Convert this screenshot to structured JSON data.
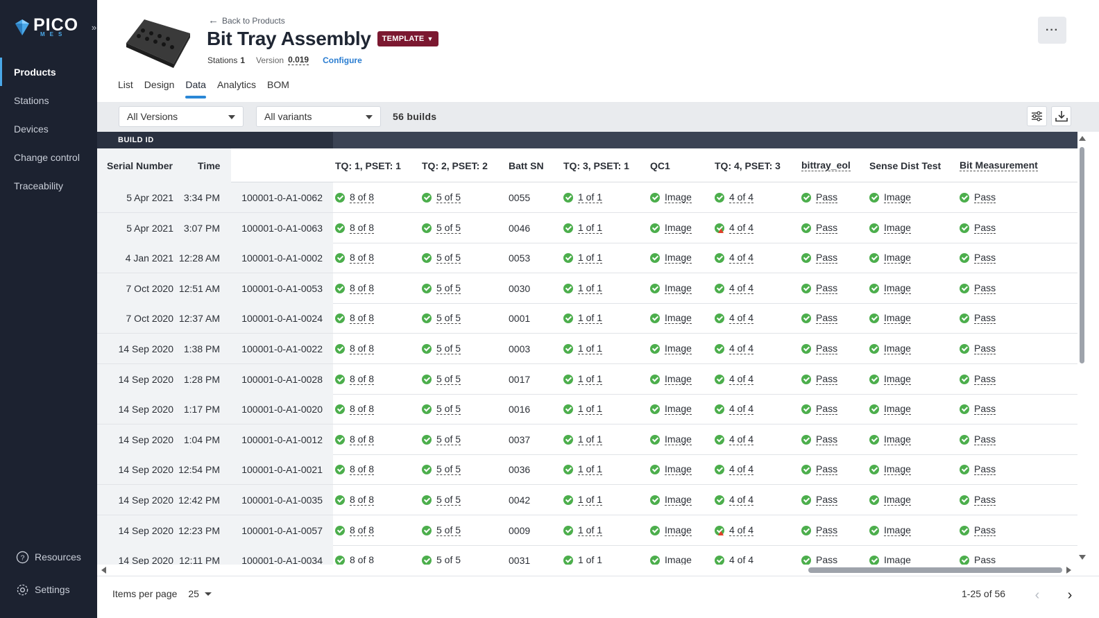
{
  "app": {
    "logo_main": "PICO",
    "logo_sub": "MES"
  },
  "sidebar": {
    "items": [
      {
        "label": "Products",
        "active": true
      },
      {
        "label": "Stations"
      },
      {
        "label": "Devices"
      },
      {
        "label": "Change control"
      },
      {
        "label": "Traceability"
      }
    ],
    "resources_label": "Resources",
    "settings_label": "Settings"
  },
  "header": {
    "back_label": "Back to Products",
    "title": "Bit Tray Assembly",
    "badge": "TEMPLATE",
    "stations_label": "Stations",
    "stations_value": "1",
    "version_label": "Version",
    "version_value": "0.019",
    "configure_label": "Configure",
    "more_label": "···"
  },
  "tabs": [
    "List",
    "Design",
    "Data",
    "Analytics",
    "BOM"
  ],
  "active_tab": "Data",
  "filters": {
    "versions": "All Versions",
    "variants": "All variants",
    "builds": "56 builds"
  },
  "table": {
    "build_id_label": "BUILD ID",
    "headers": {
      "serial": "Serial Number",
      "time": "Time",
      "tq1": "TQ: 1, PSET: 1",
      "tq2": "TQ: 2, PSET: 2",
      "batt": "Batt SN",
      "tq3": "TQ: 3, PSET: 1",
      "qc1": "QC1",
      "tq4": "TQ: 4, PSET: 3",
      "eol": "bittray_eol",
      "sense": "Sense Dist Test",
      "bit": "Bit Measurement"
    },
    "rows": [
      {
        "date": "5 Apr 2021",
        "time": "3:34 PM",
        "build": "100001-0-A1-0062",
        "tq1": "8 of 8",
        "tq2": "5 of 5",
        "batt": "0055",
        "tq3": "1 of 1",
        "qc1": "Image",
        "tq4": "4 of 4",
        "tq4_warn": false,
        "eol": "Pass",
        "sense": "Image",
        "bit": "Pass"
      },
      {
        "date": "5 Apr 2021",
        "time": "3:07 PM",
        "build": "100001-0-A1-0063",
        "tq1": "8 of 8",
        "tq2": "5 of 5",
        "batt": "0046",
        "tq3": "1 of 1",
        "qc1": "Image",
        "tq4": "4 of 4",
        "tq4_warn": true,
        "eol": "Pass",
        "sense": "Image",
        "bit": "Pass"
      },
      {
        "date": "4 Jan 2021",
        "time": "12:28 AM",
        "build": "100001-0-A1-0002",
        "tq1": "8 of 8",
        "tq2": "5 of 5",
        "batt": "0053",
        "tq3": "1 of 1",
        "qc1": "Image",
        "tq4": "4 of 4",
        "tq4_warn": false,
        "eol": "Pass",
        "sense": "Image",
        "bit": "Pass"
      },
      {
        "date": "7 Oct 2020",
        "time": "12:51 AM",
        "build": "100001-0-A1-0053",
        "tq1": "8 of 8",
        "tq2": "5 of 5",
        "batt": "0030",
        "tq3": "1 of 1",
        "qc1": "Image",
        "tq4": "4 of 4",
        "tq4_warn": false,
        "eol": "Pass",
        "sense": "Image",
        "bit": "Pass"
      },
      {
        "date": "7 Oct 2020",
        "time": "12:37 AM",
        "build": "100001-0-A1-0024",
        "tq1": "8 of 8",
        "tq2": "5 of 5",
        "batt": "0001",
        "tq3": "1 of 1",
        "qc1": "Image",
        "tq4": "4 of 4",
        "tq4_warn": false,
        "eol": "Pass",
        "sense": "Image",
        "bit": "Pass"
      },
      {
        "date": "14 Sep 2020",
        "time": "1:38 PM",
        "build": "100001-0-A1-0022",
        "tq1": "8 of 8",
        "tq2": "5 of 5",
        "batt": "0003",
        "tq3": "1 of 1",
        "qc1": "Image",
        "tq4": "4 of 4",
        "tq4_warn": false,
        "eol": "Pass",
        "sense": "Image",
        "bit": "Pass"
      },
      {
        "date": "14 Sep 2020",
        "time": "1:28 PM",
        "build": "100001-0-A1-0028",
        "tq1": "8 of 8",
        "tq2": "5 of 5",
        "batt": "0017",
        "tq3": "1 of 1",
        "qc1": "Image",
        "tq4": "4 of 4",
        "tq4_warn": false,
        "eol": "Pass",
        "sense": "Image",
        "bit": "Pass"
      },
      {
        "date": "14 Sep 2020",
        "time": "1:17 PM",
        "build": "100001-0-A1-0020",
        "tq1": "8 of 8",
        "tq2": "5 of 5",
        "batt": "0016",
        "tq3": "1 of 1",
        "qc1": "Image",
        "tq4": "4 of 4",
        "tq4_warn": false,
        "eol": "Pass",
        "sense": "Image",
        "bit": "Pass"
      },
      {
        "date": "14 Sep 2020",
        "time": "1:04 PM",
        "build": "100001-0-A1-0012",
        "tq1": "8 of 8",
        "tq2": "5 of 5",
        "batt": "0037",
        "tq3": "1 of 1",
        "qc1": "Image",
        "tq4": "4 of 4",
        "tq4_warn": false,
        "eol": "Pass",
        "sense": "Image",
        "bit": "Pass"
      },
      {
        "date": "14 Sep 2020",
        "time": "12:54 PM",
        "build": "100001-0-A1-0021",
        "tq1": "8 of 8",
        "tq2": "5 of 5",
        "batt": "0036",
        "tq3": "1 of 1",
        "qc1": "Image",
        "tq4": "4 of 4",
        "tq4_warn": false,
        "eol": "Pass",
        "sense": "Image",
        "bit": "Pass"
      },
      {
        "date": "14 Sep 2020",
        "time": "12:42 PM",
        "build": "100001-0-A1-0035",
        "tq1": "8 of 8",
        "tq2": "5 of 5",
        "batt": "0042",
        "tq3": "1 of 1",
        "qc1": "Image",
        "tq4": "4 of 4",
        "tq4_warn": false,
        "eol": "Pass",
        "sense": "Image",
        "bit": "Pass"
      },
      {
        "date": "14 Sep 2020",
        "time": "12:23 PM",
        "build": "100001-0-A1-0057",
        "tq1": "8 of 8",
        "tq2": "5 of 5",
        "batt": "0009",
        "tq3": "1 of 1",
        "qc1": "Image",
        "tq4": "4 of 4",
        "tq4_warn": true,
        "eol": "Pass",
        "sense": "Image",
        "bit": "Pass"
      },
      {
        "date": "14 Sep 2020",
        "time": "12:11 PM",
        "build": "100001-0-A1-0034",
        "tq1": "8 of 8",
        "tq2": "5 of 5",
        "batt": "0031",
        "tq3": "1 of 1",
        "qc1": "Image",
        "tq4": "4 of 4",
        "tq4_warn": false,
        "eol": "Pass",
        "sense": "Image",
        "bit": "Pass"
      }
    ]
  },
  "footer": {
    "items_per_page_label": "Items per page",
    "items_per_page_value": "25",
    "range": "1-25 of 56"
  },
  "colors": {
    "sidebar_bg": "#1c2230",
    "accent": "#2a87d6",
    "badge": "#7b1830",
    "success": "#4cae4c",
    "warning": "#e0412b"
  }
}
